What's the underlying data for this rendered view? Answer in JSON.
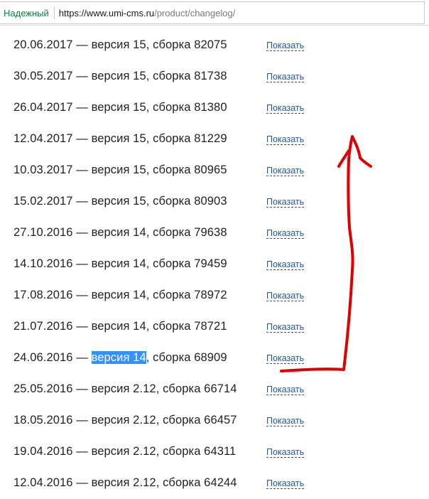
{
  "browser": {
    "security_label": "Надежный",
    "url_domain": "https://www.umi-cms.ru",
    "url_path": "/product/changelog/"
  },
  "changelog": {
    "link_label": "Показать",
    "entries": [
      {
        "date": "20.06.2017",
        "version": "версия 15",
        "build": "сборка 82075"
      },
      {
        "date": "30.05.2017",
        "version": "версия 15",
        "build": "сборка 81738"
      },
      {
        "date": "26.04.2017",
        "version": "версия 15",
        "build": "сборка 81380"
      },
      {
        "date": "12.04.2017",
        "version": "версия 15",
        "build": "сборка 81229"
      },
      {
        "date": "10.03.2017",
        "version": "версия 15",
        "build": "сборка 80965"
      },
      {
        "date": "15.02.2017",
        "version": "версия 15",
        "build": "сборка 80903"
      },
      {
        "date": "27.10.2016",
        "version": "версия 14",
        "build": "сборка 79638"
      },
      {
        "date": "14.10.2016",
        "version": "версия 14",
        "build": "сборка 79459"
      },
      {
        "date": "17.08.2016",
        "version": "версия 14",
        "build": "сборка 78972"
      },
      {
        "date": "21.07.2016",
        "version": "версия 14",
        "build": "сборка 78721"
      },
      {
        "date": "24.06.2016",
        "version": "версия 14",
        "build": "сборка 68909",
        "selected": true
      },
      {
        "date": "25.05.2016",
        "version": "версия 2.12",
        "build": "сборка 66714"
      },
      {
        "date": "18.05.2016",
        "version": "версия 2.12",
        "build": "сборка 66457"
      },
      {
        "date": "19.04.2016",
        "version": "версия 2.12",
        "build": "сборка 64311"
      },
      {
        "date": "12.04.2016",
        "version": "версия 2.12",
        "build": "сборка 64244"
      }
    ]
  },
  "annotation": {
    "color": "#e00000",
    "icon": "red-hand-drawn-arrow"
  }
}
